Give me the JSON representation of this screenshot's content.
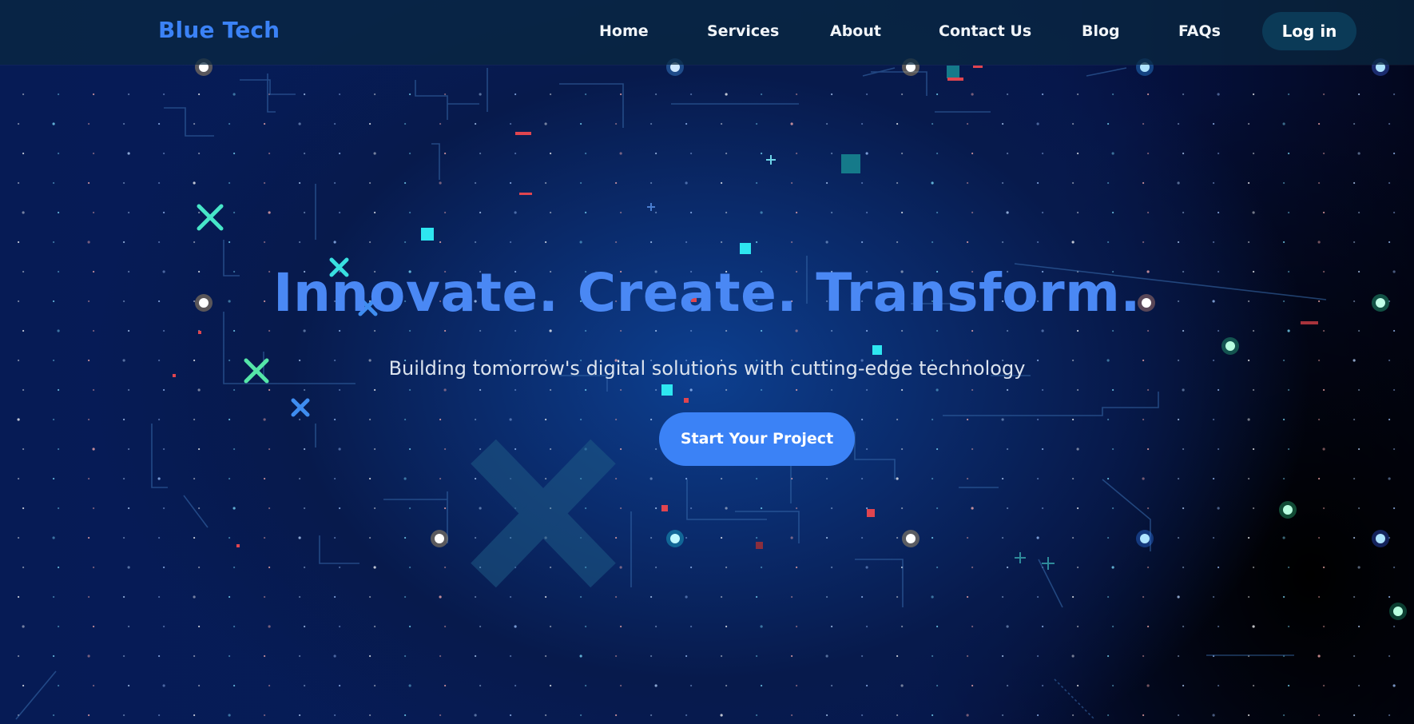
{
  "brand": {
    "name": "Blue Tech"
  },
  "nav": {
    "links": [
      "Home",
      "Services",
      "About",
      "Contact Us",
      "Blog",
      "FAQs"
    ],
    "login_label": "Log in"
  },
  "hero": {
    "title": "Innovate. Create. Transform.",
    "subtitle": "Building tomorrow's digital solutions with cutting-edge technology",
    "cta_label": "Start Your Project"
  },
  "colors": {
    "accent": "#3b82f6",
    "title": "#4a88f4",
    "navbar": "#0a2840",
    "login_button": "#0b3a57",
    "background": "#071c58"
  }
}
